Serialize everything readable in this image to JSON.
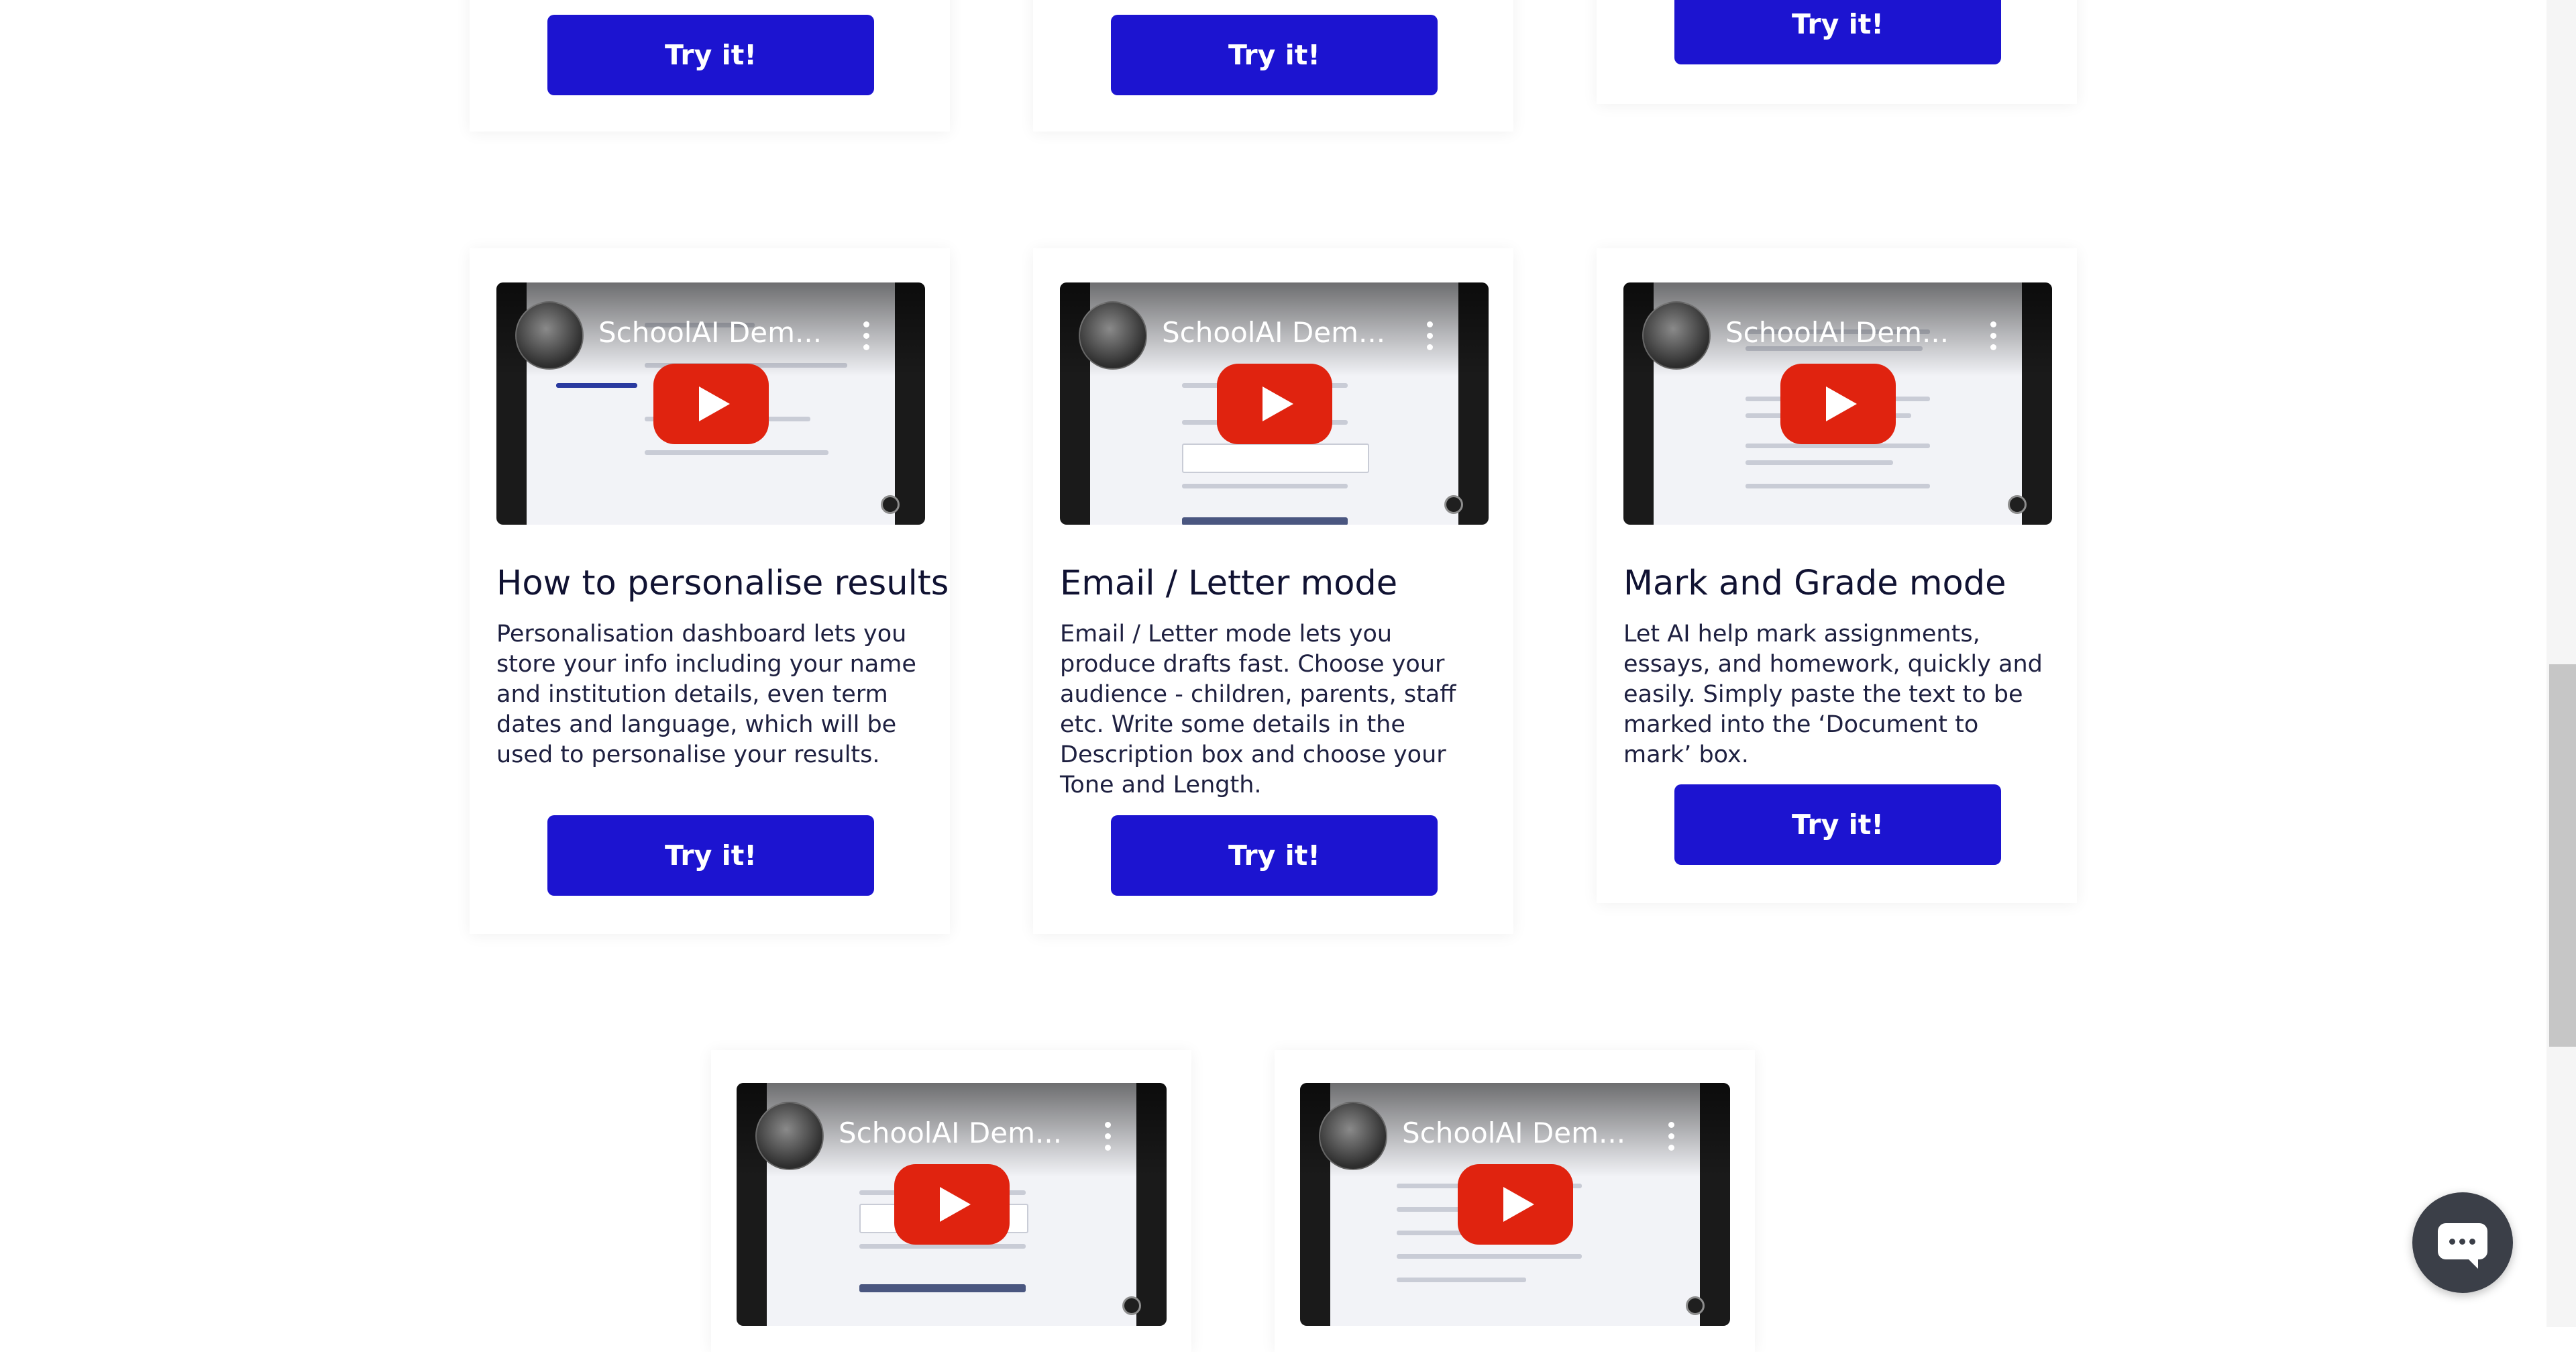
{
  "colors": {
    "button": "#1c14d0",
    "button_text": "#ffffff",
    "title": "#101232",
    "body_text": "#1e2040",
    "play": "#e0230f"
  },
  "top_row": {
    "buttons": [
      "Try it!",
      "Try it!",
      "Try it!"
    ]
  },
  "cards": [
    {
      "video_title": "SchoolAI Dem...",
      "title": "How to personalise results",
      "description": "Personalisation dashboard lets you store your info including your name and institution details, even term dates and language, which will be used to personalise your results.",
      "button": "Try it!"
    },
    {
      "video_title": "SchoolAI Dem...",
      "title": "Email / Letter mode",
      "description": "Email / Letter mode lets you produce drafts fast. Choose your audience - children, parents, staff etc. Write some details in the Description box and choose your Tone and Length.",
      "button": "Try it!"
    },
    {
      "video_title": "SchoolAI Dem...",
      "title": "Mark and Grade mode",
      "description": "Let AI help mark assignments, essays, and homework, quickly and easily. Simply paste the text to be marked into the ‘Document to mark’ box.",
      "button": "Try it!"
    }
  ],
  "bottom_videos": [
    {
      "video_title": "SchoolAI Dem..."
    },
    {
      "video_title": "SchoolAI Dem..."
    }
  ],
  "icons": {
    "play": "youtube-play-icon",
    "more": "more-vertical-icon",
    "chat": "chat-icon"
  }
}
